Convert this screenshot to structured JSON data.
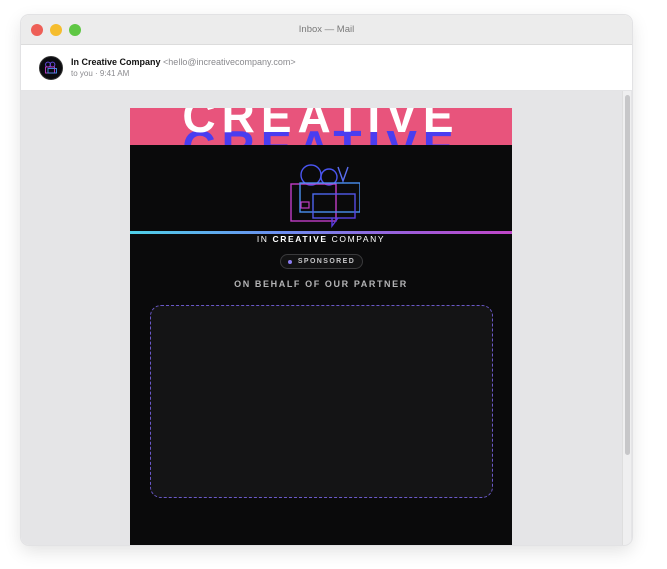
{
  "window": {
    "title": "Inbox — Mail"
  },
  "message": {
    "sender_name": "In Creative Company",
    "sender_email": "<hello@increativecompany.com>",
    "meta": "to you · 9:41 AM"
  },
  "email": {
    "banner_word": "CREATIVE",
    "brand_prefix": "IN ",
    "brand_bold": "CREATIVE",
    "brand_suffix": " COMPANY",
    "badge_label": "SPONSORED",
    "partner_heading": "ON BEHALF OF OUR PARTNER"
  },
  "colors": {
    "banner": "#e8547c",
    "banner_shadow_text": "#4a3df0",
    "email_background": "#0a0a0b",
    "accent_purple": "#8b7cf0"
  },
  "icons": {
    "traffic_close": "close-dot-icon",
    "traffic_minimize": "minimize-dot-icon",
    "traffic_zoom": "zoom-dot-icon",
    "logo": "film-camera-logo-icon",
    "badge_dot": "dot-icon"
  }
}
